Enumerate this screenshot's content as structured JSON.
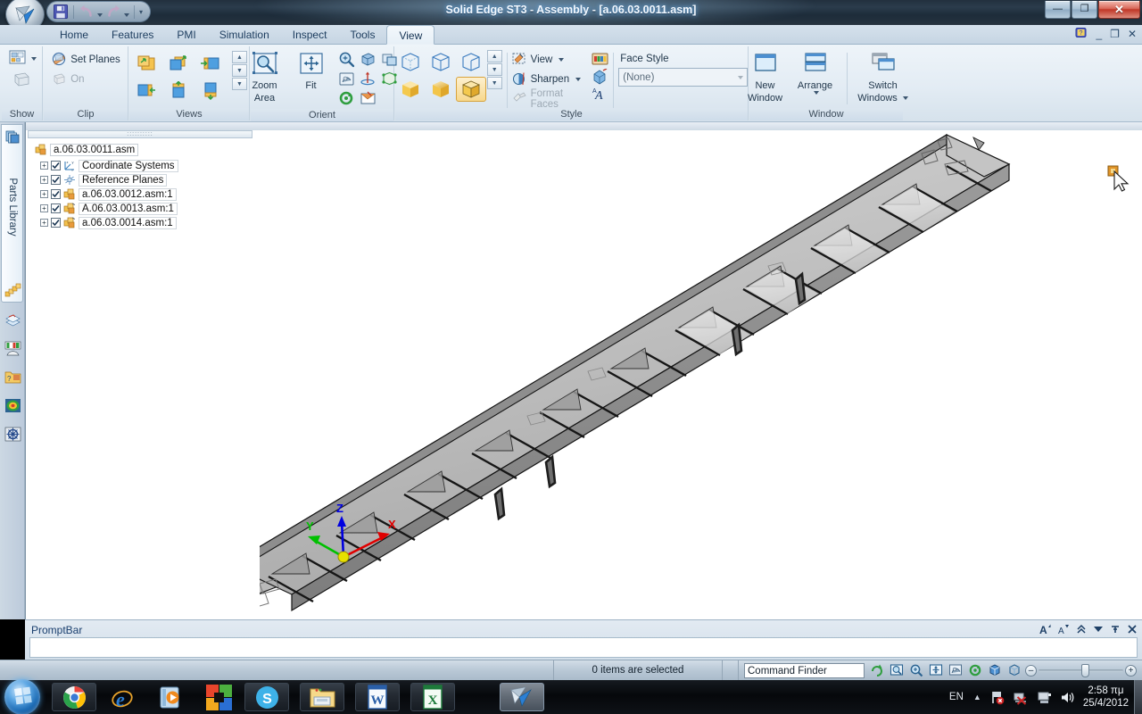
{
  "window": {
    "title": "Solid Edge ST3 - Assembly - [a.06.03.0011.asm]",
    "minimize": "—",
    "maximize": "❐",
    "close": "✕"
  },
  "quick_access": {
    "save_icon": "save-icon",
    "undo_icon": "undo-icon",
    "redo_icon": "redo-icon",
    "customize_icon": "customize-qat-icon"
  },
  "ribbon": {
    "tabs": [
      {
        "label": "Home",
        "active": false
      },
      {
        "label": "Features",
        "active": false
      },
      {
        "label": "PMI",
        "active": false
      },
      {
        "label": "Simulation",
        "active": false
      },
      {
        "label": "Inspect",
        "active": false
      },
      {
        "label": "Tools",
        "active": false
      },
      {
        "label": "View",
        "active": true
      }
    ],
    "right_icons": [
      "help-icon",
      "minimize-document-icon",
      "restore-document-icon",
      "close-document-icon"
    ],
    "groups": {
      "show": {
        "title": "Show",
        "items": [
          "show-dropdown-icon",
          "show-hidden-edges-icon"
        ]
      },
      "clip": {
        "title": "Clip",
        "set_planes": "Set Planes",
        "on": "On"
      },
      "views": {
        "title": "Views",
        "cells": [
          "view-style-1",
          "view-style-2",
          "view-style-3",
          "view-style-4",
          "view-style-5",
          "view-style-6"
        ],
        "scroll_up": "▲",
        "scroll_down": "▼",
        "more": "▼"
      },
      "orient": {
        "title": "Orient",
        "zoom_area": "Zoom\nArea",
        "zoom_area_line1": "Zoom",
        "zoom_area_line2": "Area",
        "fit": "Fit",
        "small_icons": [
          "zoom-in-icon",
          "rotate-view-icon",
          "sketch-view-icon",
          "pan-icon",
          "spin-about-icon",
          "common-views-icon",
          "refresh-icon",
          "named-views-icon"
        ]
      },
      "style": {
        "title": "Style",
        "view": "View",
        "sharpen": "Sharpen",
        "format_faces": "Format Faces",
        "face_style_label": "Face Style",
        "face_style_value": "(None)",
        "side_icons": [
          "color-manager-icon",
          "part-painter-icon",
          "text-style-icon"
        ],
        "cube_cells": [
          "wireframe-icon",
          "hidden-edges-icon",
          "visible-edges-icon",
          "shaded-icon",
          "shaded-smooth-icon",
          "shaded-with-edges-icon"
        ],
        "selected_cube_index": 5
      },
      "window": {
        "title": "Window",
        "new_window_line1": "New",
        "new_window_line2": "Window",
        "arrange": "Arrange",
        "switch_line1": "Switch",
        "switch_line2": "Windows"
      }
    }
  },
  "left_dock": {
    "parts_library_tab": "Parts Library",
    "parts_library_icon": "parts-library-icon",
    "icons": [
      "assembly-features-icon",
      "layers-icon",
      "sensors-icon",
      "library-help-icon",
      "thermal-map-icon",
      "settings-gear-icon"
    ]
  },
  "tree": {
    "root": {
      "label": "a.06.03.0011.asm",
      "icon": "assembly-icon"
    },
    "nodes": [
      {
        "label": "Coordinate Systems",
        "icon": "coordinate-systems-icon",
        "checked": true,
        "expandable": true
      },
      {
        "label": "Reference Planes",
        "icon": "reference-planes-icon",
        "checked": true,
        "expandable": true
      },
      {
        "label": "a.06.03.0012.asm:1",
        "icon": "assembly-icon",
        "checked": true,
        "expandable": true
      },
      {
        "label": "A.06.03.0013.asm:1",
        "icon": "subassembly-icon",
        "checked": true,
        "expandable": true
      },
      {
        "label": "a.06.03.0014.asm:1",
        "icon": "subassembly-icon",
        "checked": true,
        "expandable": true
      }
    ],
    "expand_glyph": "+",
    "check_glyph": "✓"
  },
  "viewport": {
    "triad": {
      "x_label": "X",
      "y_label": "Y",
      "z_label": "Z",
      "x_color": "#e00000",
      "y_color": "#00c000",
      "z_color": "#0000e0",
      "origin_color": "#e8e000"
    },
    "model_name": "conveyor-truss-assembly",
    "cursor_icon": "select-cursor-icon"
  },
  "prompt_bar": {
    "title": "PromptBar",
    "input_value": "",
    "tools": [
      "increase-font-icon",
      "decrease-font-icon",
      "collapse-icon",
      "dropdown-icon",
      "pin-icon",
      "close-icon"
    ]
  },
  "status_bar": {
    "selection": "0 items are selected",
    "command_finder": "Command Finder",
    "icons": [
      "refresh-icon",
      "fit-icon",
      "zoom-area-icon",
      "zoom-icon",
      "pan-icon",
      "spin-icon",
      "common-views-icon",
      "rotate-icon"
    ],
    "zoom_minus": "–",
    "zoom_plus": "+"
  },
  "taskbar": {
    "start": "start-orb",
    "buttons": [
      {
        "name": "google-chrome",
        "active": false
      },
      {
        "name": "internet-explorer",
        "active": false
      },
      {
        "name": "windows-media-player",
        "active": false
      },
      {
        "name": "colored-squares-app",
        "active": false
      },
      {
        "name": "skype",
        "active": false
      },
      {
        "name": "windows-explorer",
        "active": false
      },
      {
        "name": "microsoft-word",
        "active": false
      },
      {
        "name": "microsoft-excel",
        "active": false
      },
      {
        "name": "solid-edge",
        "active": true
      }
    ],
    "tray": {
      "language": "EN",
      "show_hidden": "▲",
      "icons": [
        "action-center-icon",
        "network-icon",
        "flash-drive-icon",
        "volume-icon"
      ],
      "time": "2:58 πμ",
      "date": "25/4/2012"
    }
  }
}
